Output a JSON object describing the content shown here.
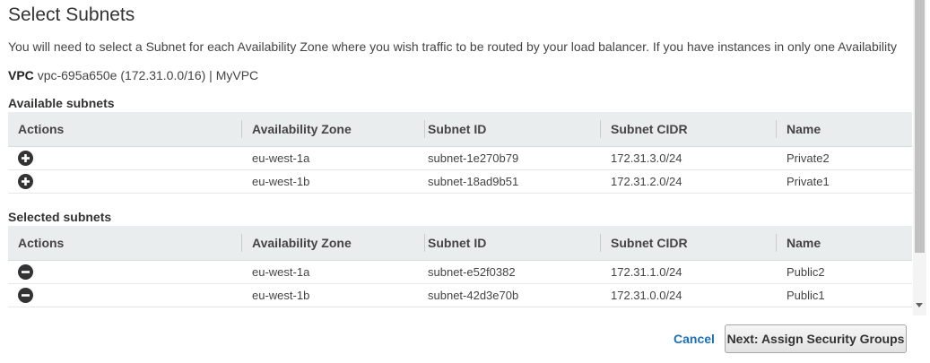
{
  "page": {
    "title": "Select Subnets",
    "description": "You will need to select a Subnet for each Availability Zone where you wish traffic to be routed by your load balancer. If you have instances in only one Availability",
    "vpc_label": "VPC",
    "vpc_value": "vpc-695a650e (172.31.0.0/16) | MyVPC"
  },
  "columns": {
    "actions": "Actions",
    "zone": "Availability Zone",
    "subnet_id": "Subnet ID",
    "cidr": "Subnet CIDR",
    "name": "Name"
  },
  "available": {
    "label": "Available subnets",
    "rows": [
      {
        "action": "add-icon",
        "zone": "eu-west-1a",
        "subnet_id": "subnet-1e270b79",
        "cidr": "172.31.3.0/24",
        "name": "Private2"
      },
      {
        "action": "add-icon",
        "zone": "eu-west-1b",
        "subnet_id": "subnet-18ad9b51",
        "cidr": "172.31.2.0/24",
        "name": "Private1"
      }
    ]
  },
  "selected": {
    "label": "Selected subnets",
    "rows": [
      {
        "action": "remove-icon",
        "zone": "eu-west-1a",
        "subnet_id": "subnet-e52f0382",
        "cidr": "172.31.1.0/24",
        "name": "Public2"
      },
      {
        "action": "remove-icon",
        "zone": "eu-west-1b",
        "subnet_id": "subnet-42d3e70b",
        "cidr": "172.31.0.0/24",
        "name": "Public1"
      }
    ]
  },
  "footer": {
    "cancel_label": "Cancel",
    "next_label": "Next: Assign Security Groups"
  },
  "colors": {
    "header_bg": "#eaeded",
    "link": "#1a6fb5",
    "icon": "#333333"
  }
}
